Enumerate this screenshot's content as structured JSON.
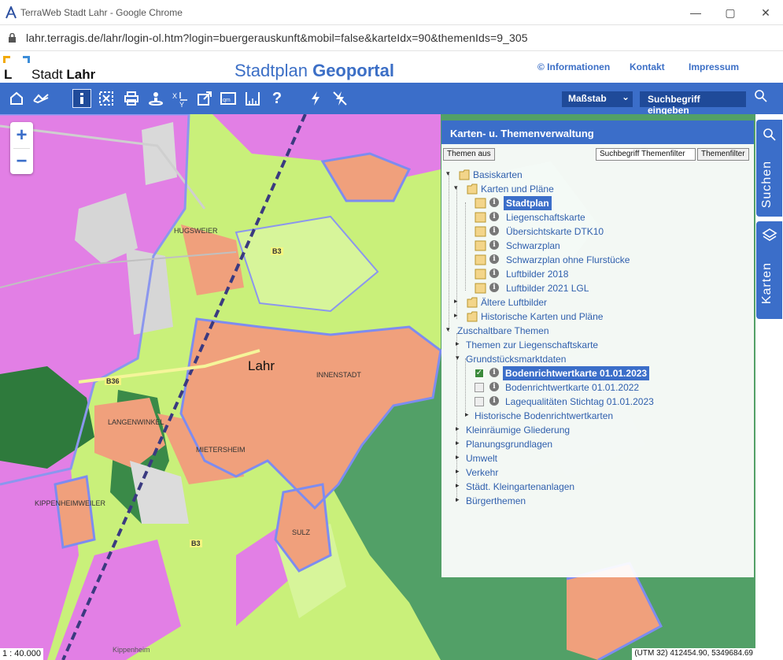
{
  "window": {
    "title": "TerraWeb Stadt Lahr - Google Chrome",
    "url": "lahr.terragis.de/lahr/login-ol.htm?login=buergerauskunft&mobil=false&karteIdx=90&themenIds=9_305",
    "minimize_icon": "minimize-icon",
    "maximize_icon": "maximize-icon",
    "close_icon": "close-icon"
  },
  "header": {
    "logo_letter": "L",
    "logo_text_plain": "Stadt ",
    "logo_text_bold": "Lahr",
    "portal_title_plain": "Stadtplan ",
    "portal_title_bold": "Geoportal",
    "links": [
      "© Informationen",
      "Kontakt",
      "Impressum"
    ]
  },
  "toolbar": {
    "icons": [
      "home-icon",
      "route-icon",
      "info-icon",
      "select-area-icon",
      "print-icon",
      "pin-user-icon",
      "coordinates-icon",
      "export-icon",
      "area-measure-icon",
      "ruler-icon",
      "help-icon",
      "lightning-icon",
      "lightning-off-icon"
    ],
    "help_glyph": "?",
    "scale_select": "Maßstab",
    "search_button": "Suchbegriff eingeben",
    "brand_color": "#3b6ec9"
  },
  "map": {
    "zoom_in": "+",
    "zoom_out": "−",
    "scale": "1 : 40.000",
    "coordinates": "(UTM 32) 412454.90, 5349684.69",
    "labels": {
      "lahr": "Lahr",
      "innenstadt": "INNENSTADT",
      "hugsweier": "HUGSWEIER",
      "langenwinkel": "LANGENWINKEL",
      "mietersheim": "MIETERSHEIM",
      "kippenheimweiler": "KIPPENHEIMWEILER",
      "sulz": "SULZ",
      "b3_top": "B3",
      "b3_bottom": "B3",
      "b36": "B36",
      "kippenheim": "Kippenheim"
    }
  },
  "sidetabs": {
    "search": "Suchen",
    "maps": "Karten"
  },
  "panel": {
    "title": "Karten- u. Themenverwaltung",
    "btn_themes_off": "Themen aus",
    "filter_input": "Suchbegriff Themenfilter",
    "btn_filter": "Themenfilter",
    "tree": {
      "basiskarten": "Basiskarten",
      "karten_plaene": "Karten und Pläne",
      "maps": [
        "Stadtplan",
        "Liegenschaftskarte",
        "Übersichtskarte DTK10",
        "Schwarzplan",
        "Schwarzplan ohne Flurstücke",
        "Luftbilder 2018",
        "Luftbilder 2021 LGL"
      ],
      "aeltere_luftbilder": "Ältere Luftbilder",
      "historische_karten": "Historische Karten und Pläne",
      "zuschaltbare": "Zuschaltbare Themen",
      "themen_liegenschaft": "Themen zur Liegenschaftskarte",
      "grundstueck": "Grundstücksmarktdaten",
      "grundstueck_items": [
        "Bodenrichtwertkarte 01.01.2023",
        "Bodenrichtwertkarte 01.01.2022",
        "Lagequalitäten Stichtag 01.01.2023"
      ],
      "hist_bodenricht": "Historische Bodenrichtwertkarten",
      "others": [
        "Kleinräumige Gliederung",
        "Planungsgrundlagen",
        "Umwelt",
        "Verkehr",
        "Städt. Kleingartenanlagen",
        "Bürgerthemen"
      ]
    }
  }
}
